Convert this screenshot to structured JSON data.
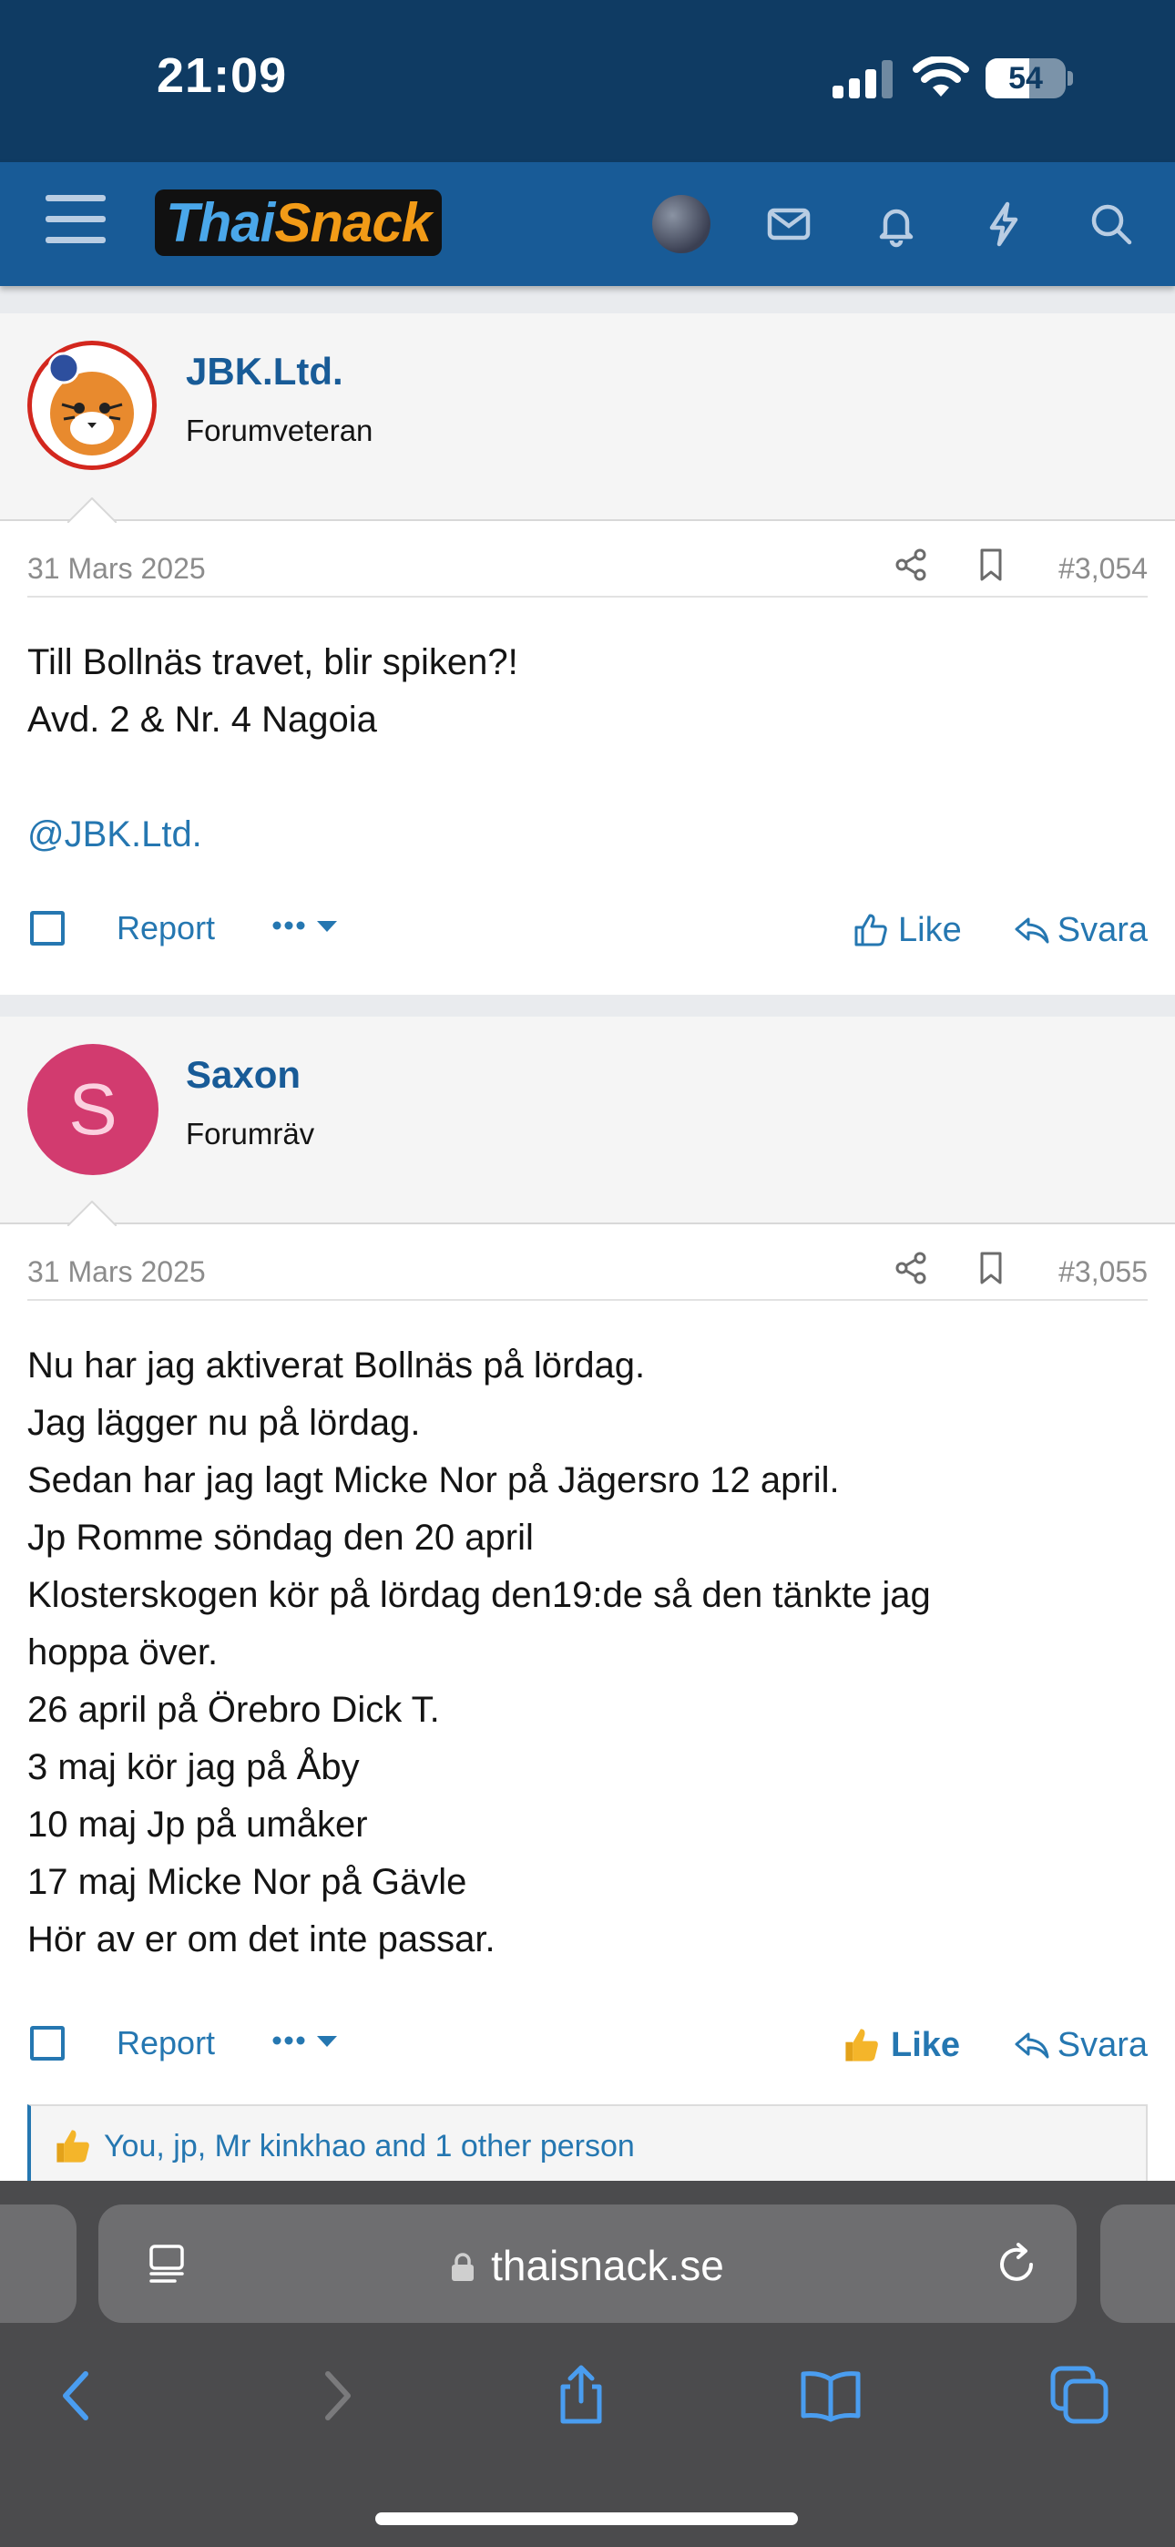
{
  "status_bar": {
    "time": "21:09",
    "battery": "54",
    "battery_level": 0.54
  },
  "nav": {
    "logo_part1": "Thai",
    "logo_part2": "Snack",
    "icons": [
      "menu-icon",
      "avatar",
      "mail-icon",
      "bell-icon",
      "lightning-icon",
      "search-icon"
    ]
  },
  "posts": [
    {
      "username": "JBK.Ltd.",
      "user_title": "Forumveteran",
      "date": "31 Mars 2025",
      "post_number": "#3,054",
      "lines": [
        "Till Bollnäs travet, blir spiken?!",
        "Avd. 2 & Nr. 4 Nagoia",
        "",
        "@JBK.Ltd."
      ],
      "report_label": "Report",
      "like_label": "Like",
      "reply_label": "Svara"
    },
    {
      "username": "Saxon",
      "avatar_letter": "S",
      "user_title": "Forumräv",
      "date": "31 Mars 2025",
      "post_number": "#3,055",
      "lines": [
        "Nu har jag aktiverat Bollnäs på lördag.",
        "Jag lägger nu på lördag.",
        "Sedan har jag lagt Micke Nor på Jägersro 12 april.",
        "Jp Romme söndag den 20 april",
        "Klosterskogen kör på lördag den19:de så den tänkte jag",
        "hoppa över.",
        "26 april på Örebro Dick T.",
        "3 maj kör jag på Åby",
        "10 maj Jp på umåker",
        "17 maj Micke Nor på Gävle",
        "Hör av er om det inte passar."
      ],
      "report_label": "Report",
      "like_label": "Like",
      "reply_label": "Svara",
      "reactions_text": "You, jp, Mr kinkhao and 1 other person"
    }
  ],
  "browser": {
    "url": "thaisnack.se"
  },
  "colors": {
    "brand_blue": "#185b97",
    "status_bg": "#0f3b63",
    "link": "#2577b1",
    "saxon_avatar": "#d23b6f"
  }
}
